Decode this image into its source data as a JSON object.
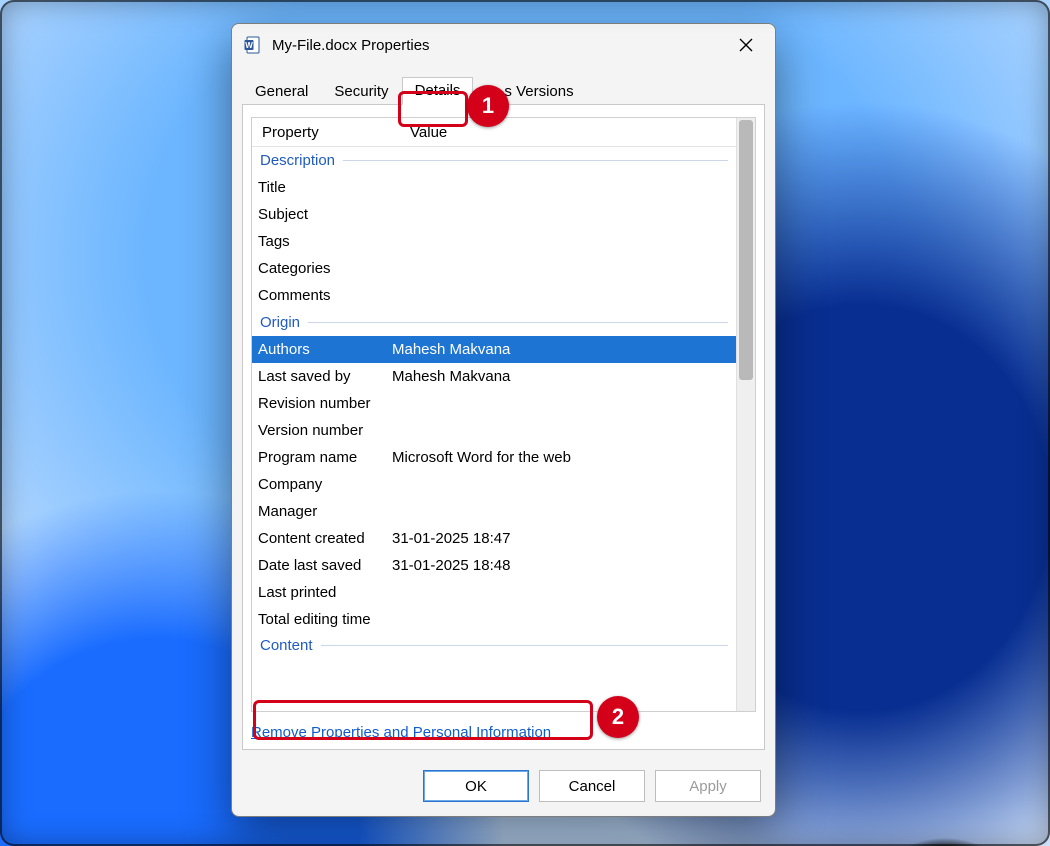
{
  "window": {
    "title": "My-File.docx Properties",
    "icon": "word-doc-icon"
  },
  "tabs": {
    "general": "General",
    "security": "Security",
    "details": "Details",
    "previous": "s Versions"
  },
  "headers": {
    "property": "Property",
    "value": "Value"
  },
  "groups": {
    "description": {
      "label": "Description",
      "rows": [
        {
          "k": "Title",
          "v": ""
        },
        {
          "k": "Subject",
          "v": ""
        },
        {
          "k": "Tags",
          "v": ""
        },
        {
          "k": "Categories",
          "v": ""
        },
        {
          "k": "Comments",
          "v": ""
        }
      ]
    },
    "origin": {
      "label": "Origin",
      "rows": [
        {
          "k": "Authors",
          "v": "Mahesh Makvana",
          "selected": true
        },
        {
          "k": "Last saved by",
          "v": "Mahesh Makvana"
        },
        {
          "k": "Revision number",
          "v": ""
        },
        {
          "k": "Version number",
          "v": ""
        },
        {
          "k": "Program name",
          "v": "Microsoft Word for the web"
        },
        {
          "k": "Company",
          "v": ""
        },
        {
          "k": "Manager",
          "v": ""
        },
        {
          "k": "Content created",
          "v": "31-01-2025 18:47"
        },
        {
          "k": "Date last saved",
          "v": "31-01-2025 18:48"
        },
        {
          "k": "Last printed",
          "v": ""
        },
        {
          "k": "Total editing time",
          "v": ""
        }
      ]
    },
    "content": {
      "label": "Content",
      "rows": []
    }
  },
  "link": "Remove Properties and Personal Information",
  "buttons": {
    "ok": "OK",
    "cancel": "Cancel",
    "apply": "Apply"
  },
  "annotations": {
    "badge1": "1",
    "badge2": "2"
  }
}
